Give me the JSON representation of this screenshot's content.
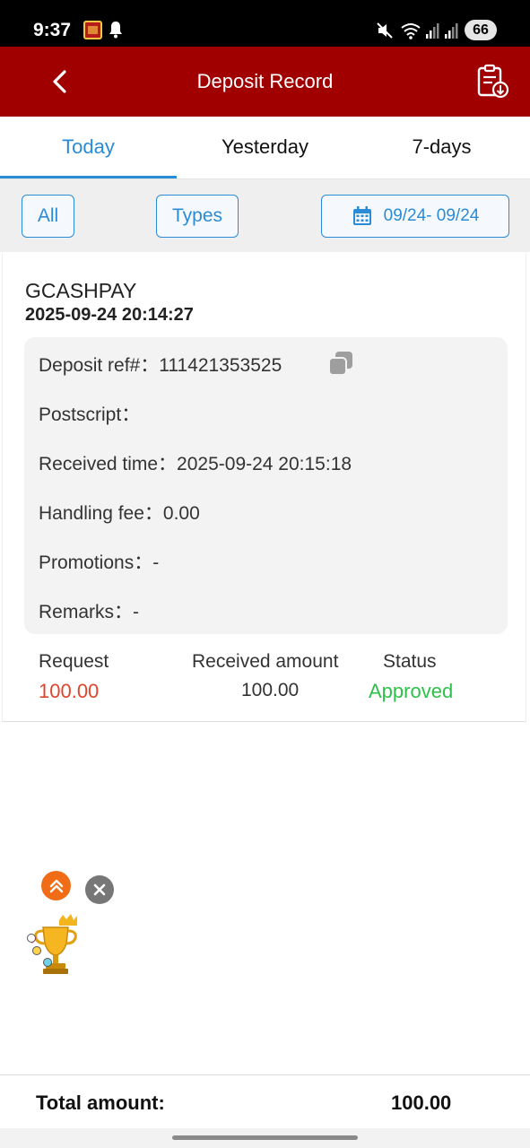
{
  "status_bar": {
    "time": "9:37",
    "battery": "66"
  },
  "header": {
    "title": "Deposit Record"
  },
  "tabs": [
    {
      "label": "Today",
      "active": true
    },
    {
      "label": "Yesterday",
      "active": false
    },
    {
      "label": "7-days",
      "active": false
    }
  ],
  "filters": {
    "all_label": "All",
    "types_label": "Types",
    "date_range": "09/24- 09/24"
  },
  "record": {
    "method": "GCASHPAY",
    "datetime": "2025-09-24 20:14:27",
    "details": {
      "deposit_ref": "Deposit ref#：111421353525",
      "postscript": "Postscript：",
      "received_time": "Received time：2025-09-24 20:15:18",
      "handling_fee": "Handling fee：0.00",
      "promotions": "Promotions：-",
      "remarks": "Remarks：-"
    },
    "summary": {
      "request_label": "Request",
      "request_value": "100.00",
      "received_label": "Received amount",
      "received_value": "100.00",
      "status_label": "Status",
      "status_value": "Approved"
    }
  },
  "footer": {
    "total_label": "Total amount:",
    "total_value": "100.00"
  },
  "colors": {
    "header_bg": "#a10000",
    "accent": "#2a8bd6",
    "request_red": "#e0452c",
    "approved_green": "#2ec14a"
  },
  "icons": [
    "back-icon",
    "download-record-icon",
    "calendar-icon",
    "copy-icon",
    "scroll-up-icon",
    "close-icon",
    "trophy-icon"
  ]
}
